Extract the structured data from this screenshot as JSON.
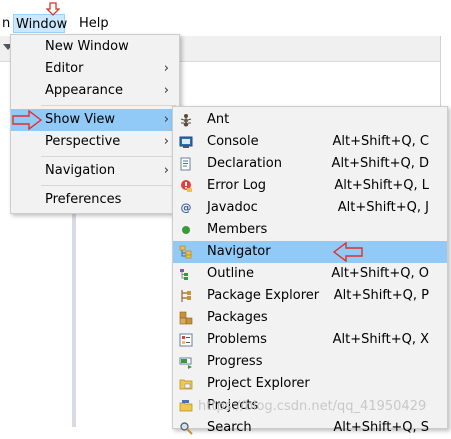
{
  "menubar": {
    "partial_left": "n",
    "window_label": "Window",
    "help_label": "Help"
  },
  "window_menu": {
    "items": [
      {
        "label": "New Window",
        "submenu": false
      },
      {
        "label": "Editor",
        "submenu": true
      },
      {
        "label": "Appearance",
        "submenu": true
      },
      {
        "label": "Show View",
        "submenu": true
      },
      {
        "label": "Perspective",
        "submenu": true
      },
      {
        "label": "Navigation",
        "submenu": true
      },
      {
        "label": "Preferences",
        "submenu": false
      }
    ],
    "highlighted": "Show View"
  },
  "show_view_menu": {
    "items": [
      {
        "label": "Ant",
        "shortcut": "",
        "icon": "ant-icon"
      },
      {
        "label": "Console",
        "shortcut": "Alt+Shift+Q, C",
        "icon": "console-icon"
      },
      {
        "label": "Declaration",
        "shortcut": "Alt+Shift+Q, D",
        "icon": "declaration-icon"
      },
      {
        "label": "Error Log",
        "shortcut": "Alt+Shift+Q, L",
        "icon": "error-log-icon"
      },
      {
        "label": "Javadoc",
        "shortcut": "Alt+Shift+Q, J",
        "icon": "javadoc-icon"
      },
      {
        "label": "Members",
        "shortcut": "",
        "icon": "members-icon"
      },
      {
        "label": "Navigator",
        "shortcut": "",
        "icon": "navigator-icon"
      },
      {
        "label": "Outline",
        "shortcut": "Alt+Shift+Q, O",
        "icon": "outline-icon"
      },
      {
        "label": "Package Explorer",
        "shortcut": "Alt+Shift+Q, P",
        "icon": "package-explorer-icon"
      },
      {
        "label": "Packages",
        "shortcut": "",
        "icon": "packages-icon"
      },
      {
        "label": "Problems",
        "shortcut": "Alt+Shift+Q, X",
        "icon": "problems-icon"
      },
      {
        "label": "Progress",
        "shortcut": "",
        "icon": "progress-icon"
      },
      {
        "label": "Project Explorer",
        "shortcut": "",
        "icon": "project-explorer-icon"
      },
      {
        "label": "Projects",
        "shortcut": "",
        "icon": "projects-icon"
      },
      {
        "label": "Search",
        "shortcut": "Alt+Shift+Q, S",
        "icon": "search-icon"
      }
    ],
    "highlighted": "Navigator"
  },
  "watermark": "https://blog.csdn.net/qq_41950429",
  "colors": {
    "highlight": "#91c9f7",
    "menu_bg": "#f2f2f2",
    "annotation_arrow": "#e0302b"
  }
}
